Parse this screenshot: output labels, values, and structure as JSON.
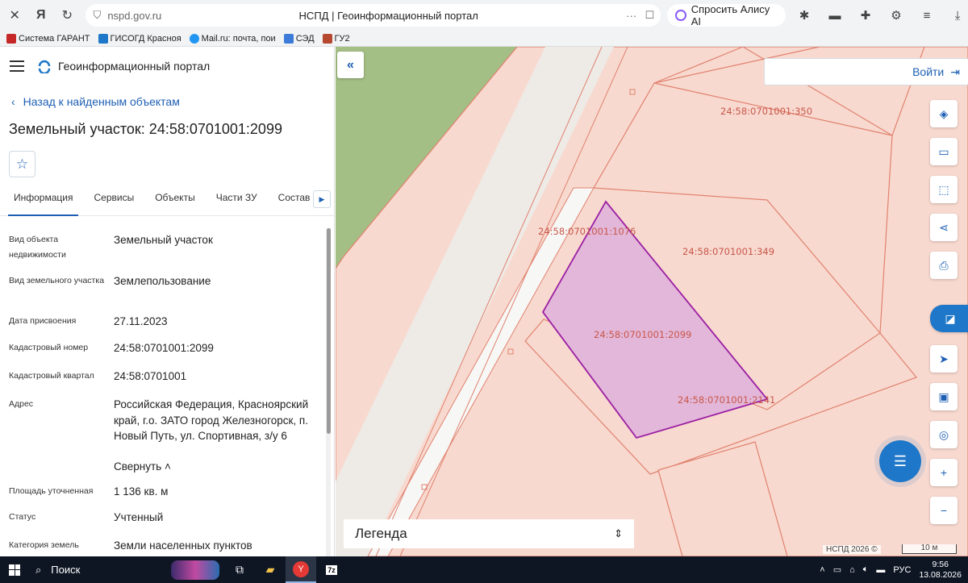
{
  "browser": {
    "url_domain": "nspd.gov.ru",
    "page_title": "НСПД | Геоинформационный портал",
    "alice_label": "Спросить Алису AI",
    "bookmarks": [
      "Система ГАРАНТ",
      "ГИСОГД Красноя",
      "Mail.ru: почта, пои",
      "СЭД",
      "ГУ2"
    ]
  },
  "panel": {
    "portal_name": "Геоинформационный портал",
    "back_label": "Назад к найденным объектам",
    "object_title": "Земельный участок: 24:58:0701001:2099",
    "tabs": [
      "Информация",
      "Сервисы",
      "Объекты",
      "Части ЗУ",
      "Состав"
    ],
    "props": [
      {
        "key": "Вид объекта недвижимости",
        "value": "Земельный участок"
      },
      {
        "key": "Вид земельного участка",
        "value": "Землепользование"
      },
      {
        "key": "Дата присвоения",
        "value": "27.11.2023"
      },
      {
        "key": "Кадастровый номер",
        "value": "24:58:0701001:2099"
      },
      {
        "key": "Кадастровый квартал",
        "value": "24:58:0701001"
      },
      {
        "key": "Адрес",
        "value": "Российская Федерация, Красноярский край, г.о. ЗАТО город Железногорск, п. Новый Путь, ул. Спортивная, з/у 6"
      },
      {
        "key": "Площадь уточненная",
        "value": "1 136 кв. м"
      },
      {
        "key": "Статус",
        "value": "Учтенный"
      },
      {
        "key": "Категория земель",
        "value": "Земли населенных пунктов"
      }
    ],
    "collapse_label": "Свернуть"
  },
  "map": {
    "login_label": "Войти",
    "legend_label": "Легенда",
    "attribution": "НСПД 2026 ©",
    "scale_label": "10 м",
    "labels": {
      "p350": "24:58:0701001:350",
      "p1076": "24:58:0701001:1076",
      "p349": "24:58:0701001:349",
      "p2099": "24:58:0701001:2099",
      "p2141": "24:58:0701001:2141"
    },
    "colors": {
      "parcel_fill": "#f8d9cf",
      "parcel_stroke": "#e0826f",
      "selected_fill": "#e3b7d9",
      "selected_stroke": "#9b1fa3",
      "forest": "#a4bf85",
      "accent": "#1e77c8"
    }
  },
  "taskbar": {
    "search_label": "Поиск",
    "lang": "РУС",
    "time": "9:56",
    "date": "13.08.2026"
  }
}
